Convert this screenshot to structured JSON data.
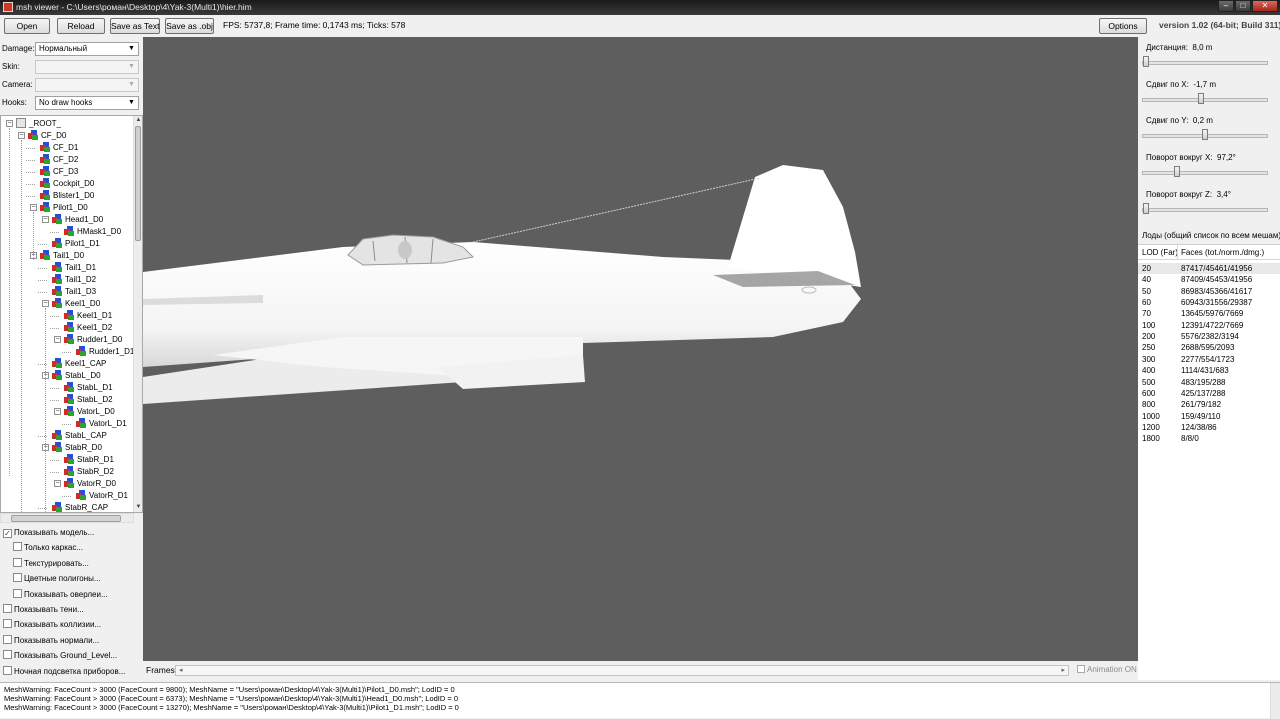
{
  "window": {
    "title": "msh viewer - C:\\Users\\роман\\Desktop\\4\\Yak-3(Multi1)\\hier.him"
  },
  "toolbar": {
    "open": "Open",
    "reload": "Reload",
    "save_text": "Save as Text",
    "save_obj": "Save as .obj",
    "fps": "FPS: 5737,8; Frame time: 0,1743 ms; Ticks: 578",
    "options": "Options",
    "version": "version 1.02 (64-bit; Build 311)"
  },
  "left": {
    "damage_label": "Damage:",
    "damage_value": "Нормальный",
    "skin_label": "Skin:",
    "skin_value": "",
    "camera_label": "Camera:",
    "camera_value": "",
    "hooks_label": "Hooks:",
    "hooks_value": "No draw hooks"
  },
  "tree": [
    {
      "label": "_ROOT_",
      "depth": 0,
      "toggle": "−",
      "root": true
    },
    {
      "label": "CF_D0",
      "depth": 1,
      "toggle": "−"
    },
    {
      "label": "CF_D1",
      "depth": 2
    },
    {
      "label": "CF_D2",
      "depth": 2
    },
    {
      "label": "CF_D3",
      "depth": 2
    },
    {
      "label": "Cockpit_D0",
      "depth": 2
    },
    {
      "label": "Blister1_D0",
      "depth": 2
    },
    {
      "label": "Pilot1_D0",
      "depth": 2,
      "toggle": "−"
    },
    {
      "label": "Head1_D0",
      "depth": 3,
      "toggle": "−"
    },
    {
      "label": "HMask1_D0",
      "depth": 4
    },
    {
      "label": "Pilot1_D1",
      "depth": 3
    },
    {
      "label": "Tail1_D0",
      "depth": 2,
      "toggle": "−"
    },
    {
      "label": "Tail1_D1",
      "depth": 3
    },
    {
      "label": "Tail1_D2",
      "depth": 3
    },
    {
      "label": "Tail1_D3",
      "depth": 3
    },
    {
      "label": "Keel1_D0",
      "depth": 3,
      "toggle": "−"
    },
    {
      "label": "Keel1_D1",
      "depth": 4
    },
    {
      "label": "Keel1_D2",
      "depth": 4
    },
    {
      "label": "Rudder1_D0",
      "depth": 4,
      "toggle": "−"
    },
    {
      "label": "Rudder1_D1",
      "depth": 5
    },
    {
      "label": "Keel1_CAP",
      "depth": 3
    },
    {
      "label": "StabL_D0",
      "depth": 3,
      "toggle": "−"
    },
    {
      "label": "StabL_D1",
      "depth": 4
    },
    {
      "label": "StabL_D2",
      "depth": 4
    },
    {
      "label": "VatorL_D0",
      "depth": 4,
      "toggle": "−"
    },
    {
      "label": "VatorL_D1",
      "depth": 5
    },
    {
      "label": "StabL_CAP",
      "depth": 3
    },
    {
      "label": "StabR_D0",
      "depth": 3,
      "toggle": "−"
    },
    {
      "label": "StabR_D1",
      "depth": 4
    },
    {
      "label": "StabR_D2",
      "depth": 4
    },
    {
      "label": "VatorR_D0",
      "depth": 4,
      "toggle": "−"
    },
    {
      "label": "VatorR_D1",
      "depth": 5
    },
    {
      "label": "StabR_CAP",
      "depth": 3
    }
  ],
  "options": [
    {
      "label": "Показывать модель...",
      "checked": true,
      "indent": 0
    },
    {
      "label": "Только каркас...",
      "checked": false,
      "indent": 1
    },
    {
      "label": "Текстурировать...",
      "checked": false,
      "indent": 1
    },
    {
      "label": "Цветные полигоны...",
      "checked": false,
      "indent": 1
    },
    {
      "label": "Показывать оверлеи...",
      "checked": false,
      "indent": 1
    },
    {
      "label": "Показывать тени...",
      "checked": false,
      "indent": 0
    },
    {
      "label": "Показывать коллизии...",
      "checked": false,
      "indent": 0
    },
    {
      "label": "Показывать нормали...",
      "checked": false,
      "indent": 0
    },
    {
      "label": "Показывать Ground_Level...",
      "checked": false,
      "indent": 0
    },
    {
      "label": "Ночная подсветка приборов...",
      "checked": false,
      "indent": 0
    }
  ],
  "frames": {
    "label": "Frames:",
    "animation": "Animation ON"
  },
  "right": {
    "sliders": [
      {
        "label": "Дистанция:",
        "value": "8,0 m",
        "level": 0.01
      },
      {
        "label": "Сдвиг по X:",
        "value": "-1,7 m",
        "level": 0.47
      },
      {
        "label": "Сдвиг по Y:",
        "value": "0,2 m",
        "level": 0.5
      },
      {
        "label": "Поворот вокруг X:",
        "value": "97,2°",
        "level": 0.27
      },
      {
        "label": "Поворот вокруг Z:",
        "value": "3,4°",
        "level": 0.01
      }
    ],
    "lod_title": "Лоды (общий список по всем мешам):",
    "lod_headers": [
      "LOD (Far)",
      "Faces (tot./norm./dmg.)"
    ],
    "lods": [
      [
        "20",
        "87417/45461/41956"
      ],
      [
        "40",
        "87409/45453/41956"
      ],
      [
        "50",
        "86983/45366/41617"
      ],
      [
        "60",
        "60943/31556/29387"
      ],
      [
        "70",
        "13645/5976/7669"
      ],
      [
        "100",
        "12391/4722/7669"
      ],
      [
        "200",
        "5576/2382/3194"
      ],
      [
        "250",
        "2688/595/2093"
      ],
      [
        "300",
        "2277/554/1723"
      ],
      [
        "400",
        "1114/431/683"
      ],
      [
        "500",
        "483/195/288"
      ],
      [
        "600",
        "425/137/288"
      ],
      [
        "800",
        "261/79/182"
      ],
      [
        "1000",
        "159/49/110"
      ],
      [
        "1200",
        "124/38/86"
      ],
      [
        "1800",
        "8/8/0"
      ]
    ]
  },
  "log": [
    "MeshWarning: FaceCount > 3000 (FaceCount = 9800); MeshName = \"Users\\роман\\Desktop\\4\\Yak-3(Multi1)\\Pilot1_D0.msh\"; LodID = 0",
    "MeshWarning: FaceCount > 3000 (FaceCount = 6373); MeshName = \"Users\\роман\\Desktop\\4\\Yak-3(Multi1)\\Head1_D0.msh\"; LodID = 0",
    "MeshWarning: FaceCount > 3000 (FaceCount = 13270); MeshName = \"Users\\роман\\Desktop\\4\\Yak-3(Multi1)\\Pilot1_D1.msh\"; LodID = 0"
  ]
}
